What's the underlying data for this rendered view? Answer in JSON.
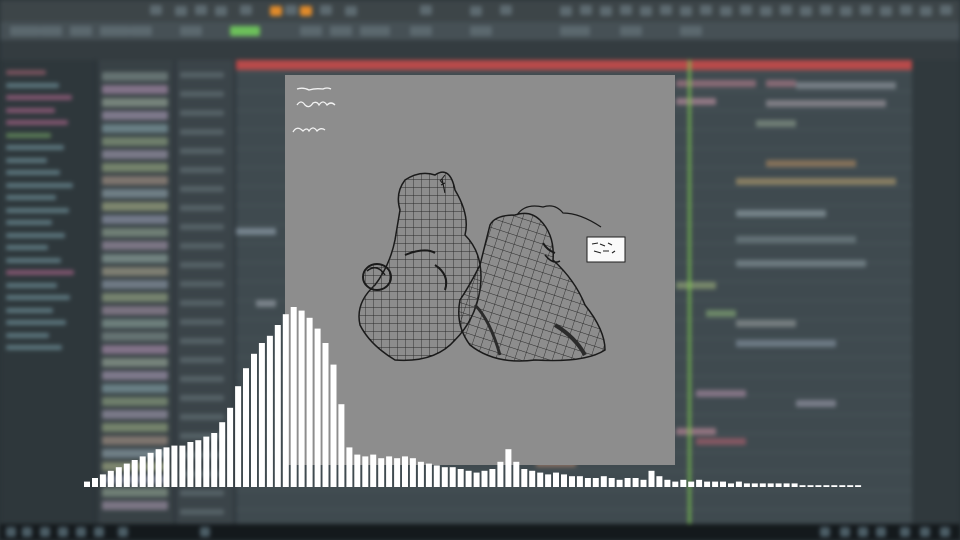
{
  "spectrum": {
    "color": "#ffffff",
    "levels": [
      0.03,
      0.05,
      0.07,
      0.09,
      0.11,
      0.13,
      0.15,
      0.17,
      0.19,
      0.21,
      0.22,
      0.23,
      0.23,
      0.25,
      0.26,
      0.28,
      0.3,
      0.36,
      0.44,
      0.56,
      0.66,
      0.74,
      0.8,
      0.84,
      0.9,
      0.96,
      1.0,
      0.98,
      0.94,
      0.88,
      0.8,
      0.68,
      0.46,
      0.22,
      0.18,
      0.17,
      0.18,
      0.16,
      0.17,
      0.16,
      0.17,
      0.16,
      0.14,
      0.13,
      0.12,
      0.11,
      0.11,
      0.1,
      0.09,
      0.08,
      0.09,
      0.1,
      0.14,
      0.21,
      0.14,
      0.1,
      0.09,
      0.08,
      0.07,
      0.08,
      0.07,
      0.06,
      0.06,
      0.05,
      0.05,
      0.06,
      0.05,
      0.04,
      0.05,
      0.05,
      0.04,
      0.09,
      0.06,
      0.04,
      0.03,
      0.04,
      0.03,
      0.04,
      0.03,
      0.03,
      0.03,
      0.02,
      0.03,
      0.02,
      0.02,
      0.02,
      0.02,
      0.02,
      0.02,
      0.02,
      0.01,
      0.01,
      0.01,
      0.01,
      0.01,
      0.01,
      0.01,
      0.01
    ]
  },
  "art": {
    "background": "#8d8d8d",
    "ink": "#1f1f1f"
  },
  "daw": {
    "accent": "#b74a4a",
    "playhead": "#7cc24f"
  }
}
